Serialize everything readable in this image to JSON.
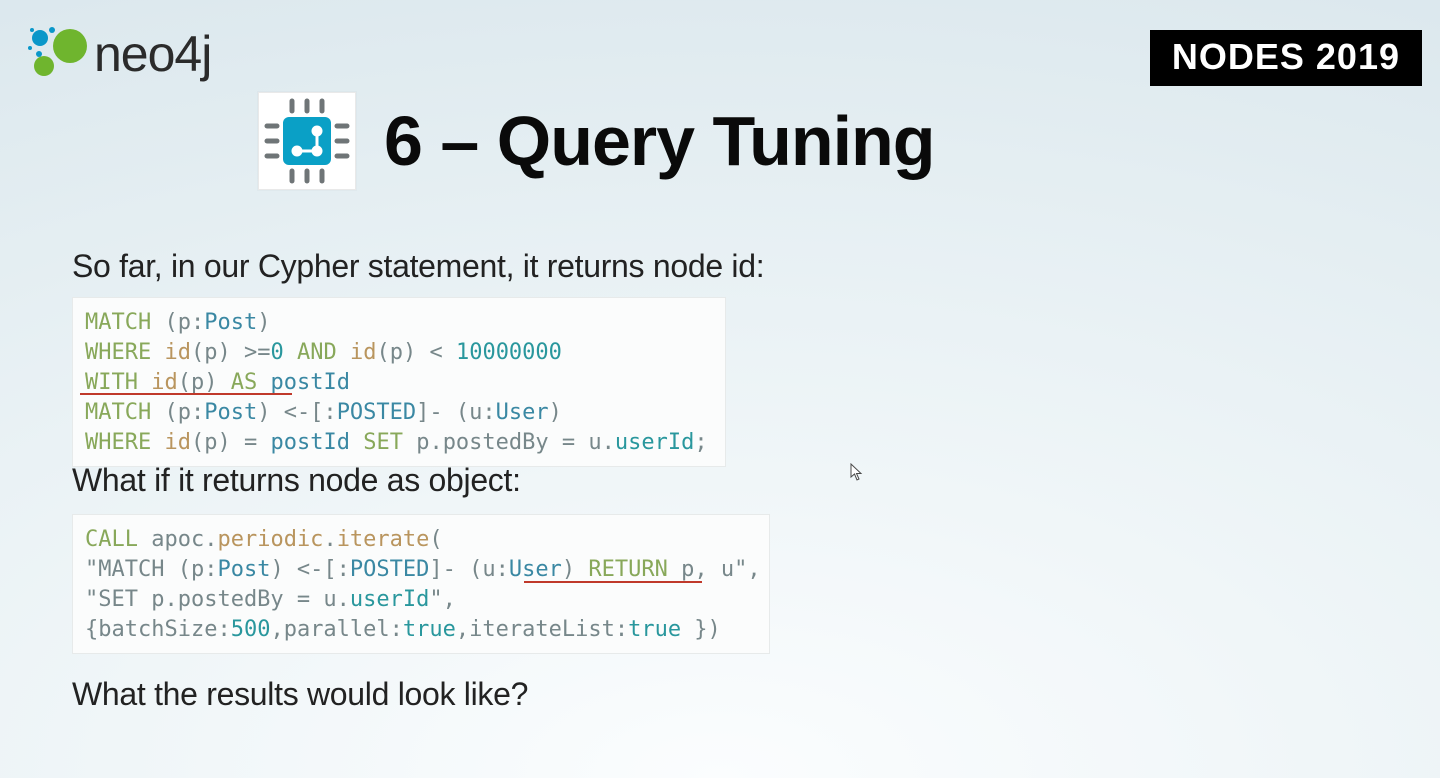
{
  "brand": {
    "name": "neo4j"
  },
  "conference": {
    "badge": "NODES 2019"
  },
  "title": "6 – Query Tuning",
  "lead1": "So far, in our Cypher statement, it returns node id:",
  "lead2": "What if it returns node as object:",
  "lead3": "What the results would look like?",
  "code1": {
    "l1a": "MATCH",
    "l1b": " (p:",
    "l1c": "Post",
    "l1d": ")",
    "l2a": "WHERE",
    "l2b": " ",
    "l2c": "id",
    "l2d": "(p) >=",
    "l2e": "0",
    "l2f": " ",
    "l2g": "AND",
    "l2h": " ",
    "l2i": "id",
    "l2j": "(p) < ",
    "l2k": "10000000",
    "l3a": "WITH",
    "l3b": " ",
    "l3c": "id",
    "l3d": "(p) ",
    "l3e": "AS",
    "l3f": " ",
    "l3g": "postId",
    "l4a": "MATCH",
    "l4b": " (p:",
    "l4c": "Post",
    "l4d": ") <-[:",
    "l4e": "POSTED",
    "l4f": "]- (u:",
    "l4g": "User",
    "l4h": ")",
    "l5a": "WHERE",
    "l5b": " ",
    "l5c": "id",
    "l5d": "(p) = ",
    "l5e": "postId",
    "l5f": " ",
    "l5g": "SET",
    "l5h": " p.postedBy = u.",
    "l5i": "userId",
    "l5j": ";"
  },
  "code2": {
    "l1a": "CALL",
    "l1b": " apoc.",
    "l1c": "periodic",
    "l1d": ".",
    "l1e": "iterate",
    "l1f": "(",
    "l2a": "\"MATCH (p:",
    "l2b": "Post",
    "l2c": ") <-[:",
    "l2d": "POSTED",
    "l2e": "]- (u:",
    "l2f": "User",
    "l2g": ") ",
    "l2h": "RETURN",
    "l2i": " p, u\"",
    "l2j": ",",
    "l3a": "\"SET p.postedBy = u.",
    "l3b": "userId",
    "l3c": "\"",
    "l3d": ",",
    "l4a": "{batchSize:",
    "l4b": "500",
    "l4c": ",parallel:",
    "l4d": "true",
    "l4e": ",iterateList:",
    "l4f": "true",
    "l4g": " })"
  }
}
